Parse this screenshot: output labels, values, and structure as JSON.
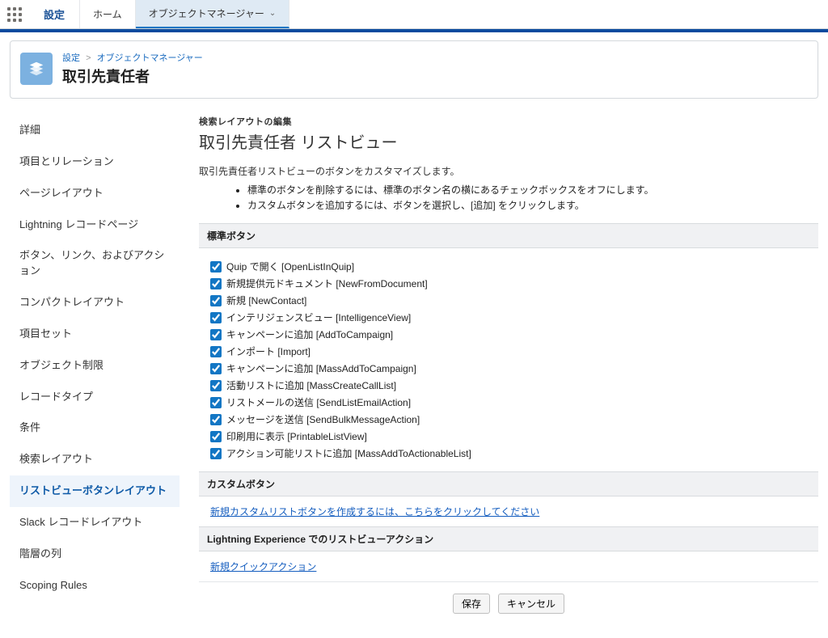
{
  "topbar": {
    "setup_label": "設定",
    "tabs": [
      {
        "label": "ホーム",
        "active": false
      },
      {
        "label": "オブジェクトマネージャー",
        "active": true
      }
    ]
  },
  "header": {
    "breadcrumb": {
      "root": "設定",
      "child": "オブジェクトマネージャー"
    },
    "title": "取引先責任者"
  },
  "sidebar": {
    "items": [
      {
        "label": "詳細",
        "active": false
      },
      {
        "label": "項目とリレーション",
        "active": false
      },
      {
        "label": "ページレイアウト",
        "active": false
      },
      {
        "label": "Lightning レコードページ",
        "active": false
      },
      {
        "label": "ボタン、リンク、およびアクション",
        "active": false
      },
      {
        "label": "コンパクトレイアウト",
        "active": false
      },
      {
        "label": "項目セット",
        "active": false
      },
      {
        "label": "オブジェクト制限",
        "active": false
      },
      {
        "label": "レコードタイプ",
        "active": false
      },
      {
        "label": "条件",
        "active": false
      },
      {
        "label": "検索レイアウト",
        "active": false
      },
      {
        "label": "リストビューボタンレイアウト",
        "active": true
      },
      {
        "label": "Slack レコードレイアウト",
        "active": false
      },
      {
        "label": "階層の列",
        "active": false
      },
      {
        "label": "Scoping Rules",
        "active": false
      }
    ]
  },
  "main": {
    "pretitle": "検索レイアウトの編集",
    "title": "取引先責任者 リストビュー",
    "description": "取引先責任者リストビューのボタンをカスタマイズします。",
    "bullets": [
      "標準のボタンを削除するには、標準のボタン名の横にあるチェックボックスをオフにします。",
      "カスタムボタンを追加するには、ボタンを選択し、[追加] をクリックします。"
    ],
    "sections": {
      "standard_header": "標準ボタン",
      "standard_buttons": [
        {
          "label": "Quip で開く [OpenListInQuip]",
          "checked": true
        },
        {
          "label": "新規提供元ドキュメント [NewFromDocument]",
          "checked": true
        },
        {
          "label": "新規 [NewContact]",
          "checked": true
        },
        {
          "label": "インテリジェンスビュー [IntelligenceView]",
          "checked": true
        },
        {
          "label": "キャンペーンに追加 [AddToCampaign]",
          "checked": true
        },
        {
          "label": "インポート [Import]",
          "checked": true
        },
        {
          "label": "キャンペーンに追加 [MassAddToCampaign]",
          "checked": true
        },
        {
          "label": "活動リストに追加 [MassCreateCallList]",
          "checked": true
        },
        {
          "label": "リストメールの送信 [SendListEmailAction]",
          "checked": true
        },
        {
          "label": "メッセージを送信 [SendBulkMessageAction]",
          "checked": true
        },
        {
          "label": "印刷用に表示 [PrintableListView]",
          "checked": true
        },
        {
          "label": "アクション可能リストに追加 [MassAddToActionableList]",
          "checked": true
        }
      ],
      "custom_header": "カスタムボタン",
      "custom_link": "新規カスタムリストボタンを作成するには、こちらをクリックしてください",
      "lex_header": "Lightning Experience でのリストビューアクション",
      "lex_link": "新規クイックアクション"
    },
    "footer": {
      "save": "保存",
      "cancel": "キャンセル"
    }
  }
}
